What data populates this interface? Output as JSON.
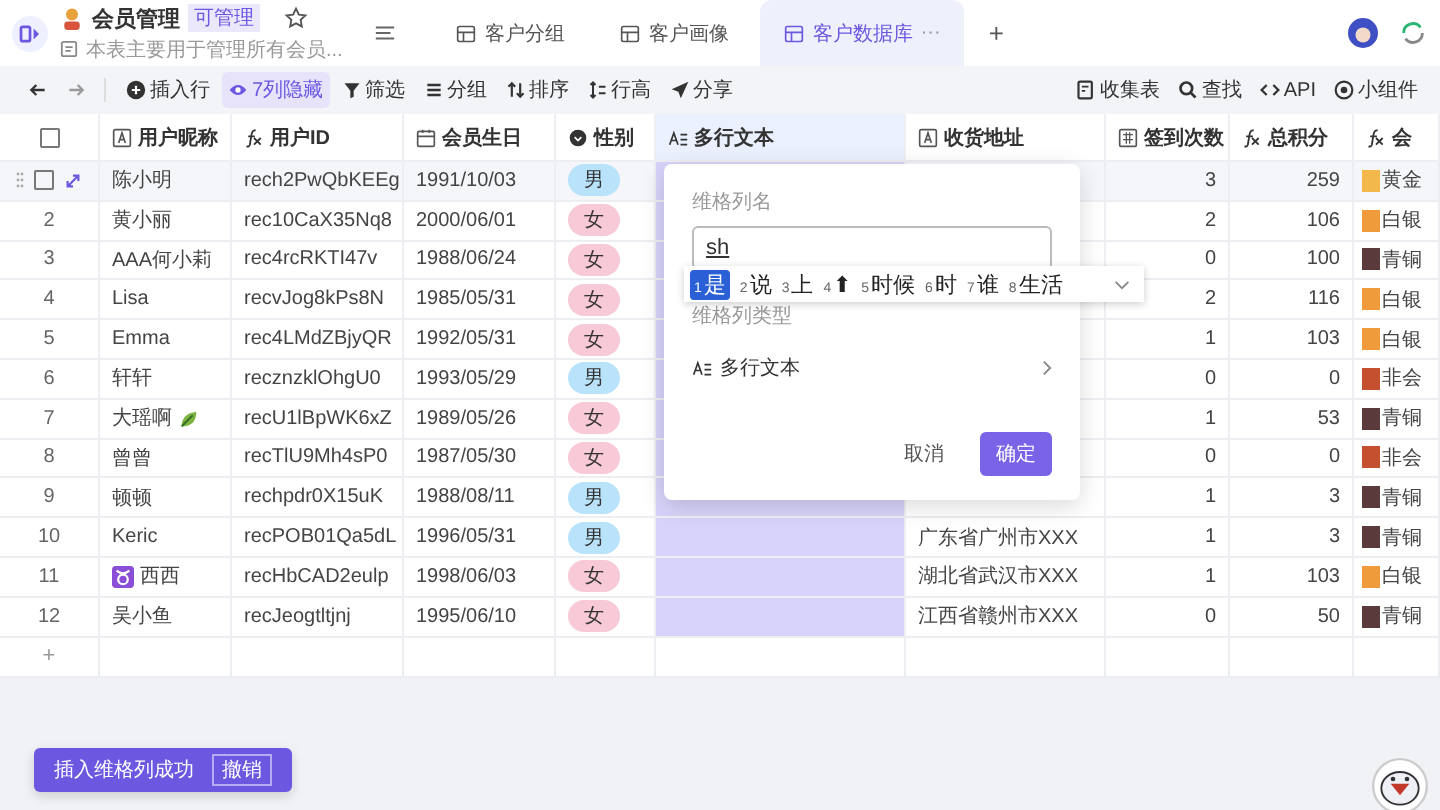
{
  "app": {
    "title": "会员管理",
    "badge": "可管理",
    "subtitle": "本表主要用于管理所有会员..."
  },
  "tabs": [
    {
      "label": "客户分组",
      "selected": false
    },
    {
      "label": "客户画像",
      "selected": false
    },
    {
      "label": "客户数据库",
      "selected": true,
      "more": "···"
    }
  ],
  "add_tab": "+",
  "toolbar": {
    "left": [
      {
        "label": "插入行",
        "kind": "insert",
        "active": false
      },
      {
        "label": "7列隐藏",
        "kind": "hide",
        "active": true
      },
      {
        "label": "筛选",
        "kind": "filter",
        "active": false
      },
      {
        "label": "分组",
        "kind": "group",
        "active": false
      },
      {
        "label": "排序",
        "kind": "sort",
        "active": false
      },
      {
        "label": "行高",
        "kind": "height",
        "active": false
      },
      {
        "label": "分享",
        "kind": "share",
        "active": false
      }
    ],
    "right": [
      {
        "label": "收集表",
        "kind": "form"
      },
      {
        "label": "查找",
        "kind": "search"
      },
      {
        "label": "API",
        "kind": "api"
      },
      {
        "label": "小组件",
        "kind": "widget"
      }
    ]
  },
  "table": {
    "all_checked": false,
    "columns": [
      {
        "label": "用户昵称",
        "kind": "text",
        "selected": false
      },
      {
        "label": "用户ID",
        "kind": "formula",
        "selected": false
      },
      {
        "label": "会员生日",
        "kind": "date",
        "selected": false
      },
      {
        "label": "性别",
        "kind": "option",
        "selected": false
      },
      {
        "label": "多行文本",
        "kind": "multiline",
        "selected": true
      },
      {
        "label": "收货地址",
        "kind": "text",
        "selected": false
      },
      {
        "label": "签到次数",
        "kind": "number",
        "selected": false
      },
      {
        "label": "总积分",
        "kind": "formula",
        "selected": false
      },
      {
        "label": "会",
        "kind": "formula",
        "selected": false
      }
    ],
    "rows": [
      {
        "hovered": true,
        "checked": false,
        "nickname": "陈小明",
        "id": "rech2PwQbKEEg",
        "birthday": "1991/10/03",
        "gender": {
          "text": "男",
          "kind": "male"
        },
        "checkins": "3",
        "points": "259",
        "level": {
          "text": "黄金",
          "color": "#f2b84b"
        }
      },
      {
        "hovered": false,
        "number": "2",
        "nickname": "黄小丽",
        "id": "rec10CaX35Nq8",
        "birthday": "2000/06/01",
        "gender": {
          "text": "女",
          "kind": "female"
        },
        "checkins": "2",
        "points": "106",
        "level": {
          "text": "白银",
          "color": "#ef9b3c"
        }
      },
      {
        "hovered": false,
        "number": "3",
        "nickname": "AAA何小莉",
        "id": "rec4rcRKTI47v",
        "birthday": "1988/06/24",
        "gender": {
          "text": "女",
          "kind": "female"
        },
        "checkins": "0",
        "points": "100",
        "level": {
          "text": "青铜",
          "color": "#5a3a3a"
        }
      },
      {
        "hovered": false,
        "number": "4",
        "nickname": "Lisa",
        "id": "recvJog8kPs8N",
        "birthday": "1985/05/31",
        "gender": {
          "text": "女",
          "kind": "female"
        },
        "checkins": "2",
        "points": "116",
        "level": {
          "text": "白银",
          "color": "#ef9b3c"
        }
      },
      {
        "hovered": false,
        "number": "5",
        "nickname": "Emma",
        "id": "rec4LMdZBjyQR",
        "birthday": "1992/05/31",
        "gender": {
          "text": "女",
          "kind": "female"
        },
        "checkins": "1",
        "points": "103",
        "level": {
          "text": "白银",
          "color": "#ef9b3c"
        }
      },
      {
        "hovered": false,
        "number": "6",
        "nickname": "轩轩",
        "id": "recznzklOhgU0",
        "birthday": "1993/05/29",
        "gender": {
          "text": "男",
          "kind": "male"
        },
        "checkins": "0",
        "points": "0",
        "level": {
          "text": "非会",
          "color": "#c4502f"
        }
      },
      {
        "hovered": false,
        "number": "7",
        "nickname": "大瑶啊",
        "kind": "emoji_after",
        "id": "recU1lBpWK6xZ",
        "birthday": "1989/05/26",
        "gender": {
          "text": "女",
          "kind": "female"
        },
        "checkins": "1",
        "points": "53",
        "level": {
          "text": "青铜",
          "color": "#5a3a3a"
        }
      },
      {
        "hovered": false,
        "number": "8",
        "nickname": "曾曾",
        "id": "recTlU9Mh4sP0",
        "birthday": "1987/05/30",
        "gender": {
          "text": "女",
          "kind": "female"
        },
        "checkins": "0",
        "points": "0",
        "level": {
          "text": "非会",
          "color": "#c4502f"
        }
      },
      {
        "hovered": false,
        "number": "9",
        "nickname": "顿顿",
        "id": "rechpdr0X15uK",
        "birthday": "1988/08/11",
        "gender": {
          "text": "男",
          "kind": "male"
        },
        "checkins": "1",
        "points": "3",
        "level": {
          "text": "青铜",
          "color": "#5a3a3a"
        }
      },
      {
        "hovered": false,
        "number": "10",
        "nickname": "Keric",
        "id": "recPOB01Qa5dL",
        "birthday": "1996/05/31",
        "gender": {
          "text": "男",
          "kind": "male"
        },
        "address": "广东省广州市XXX",
        "checkins": "1",
        "points": "3",
        "level": {
          "text": "青铜",
          "color": "#5a3a3a"
        }
      },
      {
        "hovered": false,
        "number": "11",
        "nickname": "西西",
        "kind": "emoji_before",
        "id": "recHbCAD2eulp",
        "birthday": "1998/06/03",
        "gender": {
          "text": "女",
          "kind": "female"
        },
        "address": "湖北省武汉市XXX",
        "checkins": "1",
        "points": "103",
        "level": {
          "text": "白银",
          "color": "#ef9b3c"
        }
      },
      {
        "hovered": false,
        "number": "12",
        "nickname": "吴小鱼",
        "id": "recJeogtltjnj",
        "birthday": "1995/06/10",
        "gender": {
          "text": "女",
          "kind": "female"
        },
        "address": "江西省赣州市XXX",
        "checkins": "0",
        "points": "50",
        "level": {
          "text": "青铜",
          "color": "#5a3a3a"
        }
      }
    ],
    "add_row": "+"
  },
  "popup": {
    "name_label": "维格列名",
    "name_value": "sh",
    "type_label": "维格列类型",
    "type_value": "多行文本",
    "cancel": "取消",
    "confirm": "确定"
  },
  "ime": {
    "candidates": [
      {
        "index": "1",
        "text": "是",
        "selected": true
      },
      {
        "index": "2",
        "text": "说",
        "selected": false
      },
      {
        "index": "3",
        "text": "上",
        "selected": false
      },
      {
        "index": "4",
        "text": "⬆",
        "selected": false
      },
      {
        "index": "5",
        "text": "时候",
        "selected": false
      },
      {
        "index": "6",
        "text": "时",
        "selected": false
      },
      {
        "index": "7",
        "text": "谁",
        "selected": false
      },
      {
        "index": "8",
        "text": "生活",
        "selected": false
      }
    ]
  },
  "toast": {
    "message": "插入维格列成功",
    "action": "撤销"
  }
}
